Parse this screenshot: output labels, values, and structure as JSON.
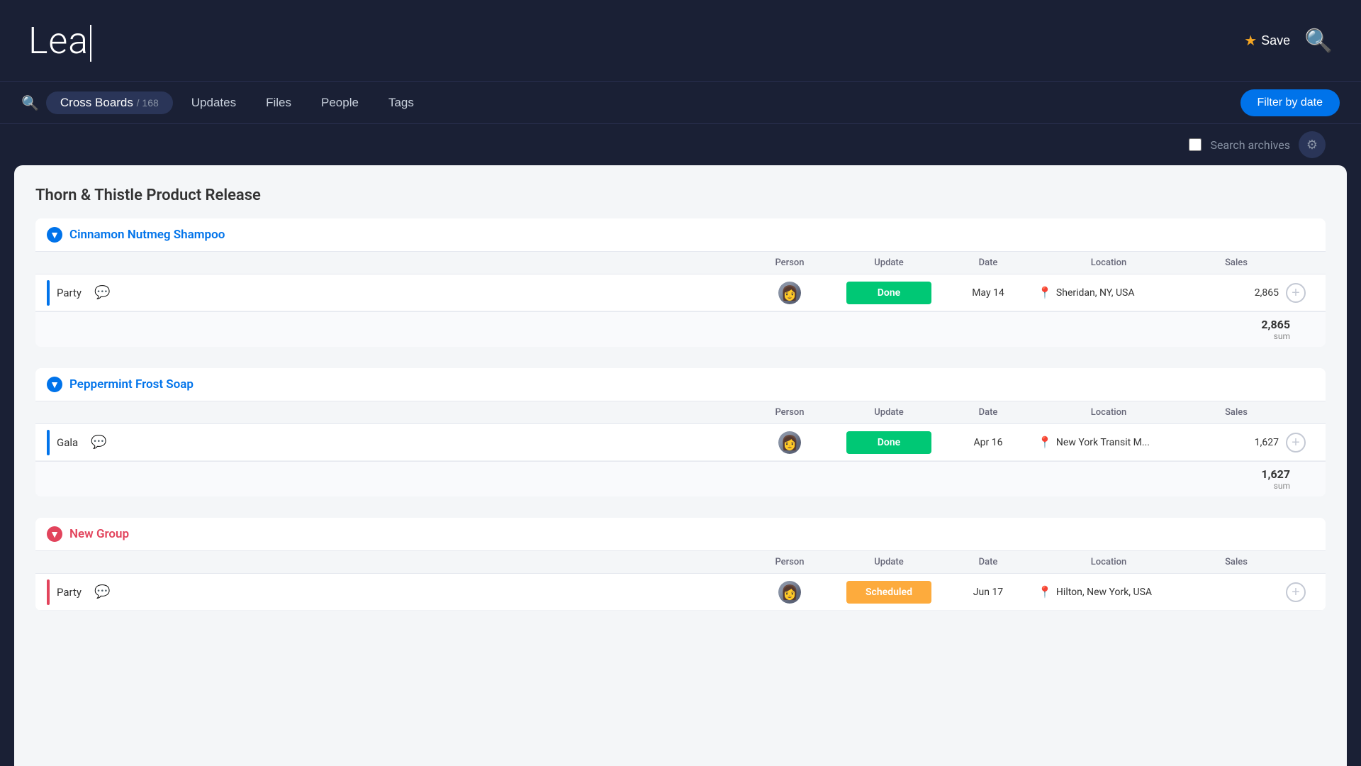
{
  "header": {
    "title": "Lea",
    "cursor": true,
    "save_label": "Save",
    "search_label": "Search"
  },
  "nav": {
    "tabs": [
      {
        "id": "cross-boards",
        "label": "Cross Boards",
        "count": "168",
        "active": true
      },
      {
        "id": "updates",
        "label": "Updates",
        "count": null,
        "active": false
      },
      {
        "id": "files",
        "label": "Files",
        "count": null,
        "active": false
      },
      {
        "id": "people",
        "label": "People",
        "count": null,
        "active": false
      },
      {
        "id": "tags",
        "label": "Tags",
        "count": null,
        "active": false
      }
    ],
    "filter_label": "Filter by date"
  },
  "toolbar": {
    "search_archives_label": "Search archives",
    "settings_icon": "gear"
  },
  "board": {
    "title": "Thorn & Thistle Product Release",
    "groups": [
      {
        "id": "group-1",
        "name": "Cinnamon Nutmeg Shampoo",
        "color": "blue",
        "columns": {
          "person": "Person",
          "update": "Update",
          "date": "Date",
          "location": "Location",
          "sales": "Sales"
        },
        "rows": [
          {
            "id": "row-1",
            "name": "Party",
            "color": "blue",
            "person_avatar": "woman",
            "status": "Done",
            "status_type": "done",
            "date": "May 14",
            "location": "Sheridan, NY, USA",
            "sales": "2,865"
          }
        ],
        "sum": {
          "value": "2,865",
          "label": "sum"
        }
      },
      {
        "id": "group-2",
        "name": "Peppermint Frost Soap",
        "color": "blue",
        "columns": {
          "person": "Person",
          "update": "Update",
          "date": "Date",
          "location": "Location",
          "sales": "Sales"
        },
        "rows": [
          {
            "id": "row-2",
            "name": "Gala",
            "color": "blue",
            "person_avatar": "woman",
            "status": "Done",
            "status_type": "done",
            "date": "Apr 16",
            "location": "New York Transit M...",
            "sales": "1,627"
          }
        ],
        "sum": {
          "value": "1,627",
          "label": "sum"
        }
      },
      {
        "id": "group-3",
        "name": "New Group",
        "color": "red",
        "columns": {
          "person": "Person",
          "update": "Update",
          "date": "Date",
          "location": "Location",
          "sales": "Sales"
        },
        "rows": [
          {
            "id": "row-3",
            "name": "Party",
            "color": "red",
            "person_avatar": "woman",
            "status": "Scheduled",
            "status_type": "scheduled",
            "date": "Jun 17",
            "location": "Hilton, New York, USA",
            "sales": ""
          }
        ],
        "sum": null
      }
    ]
  }
}
